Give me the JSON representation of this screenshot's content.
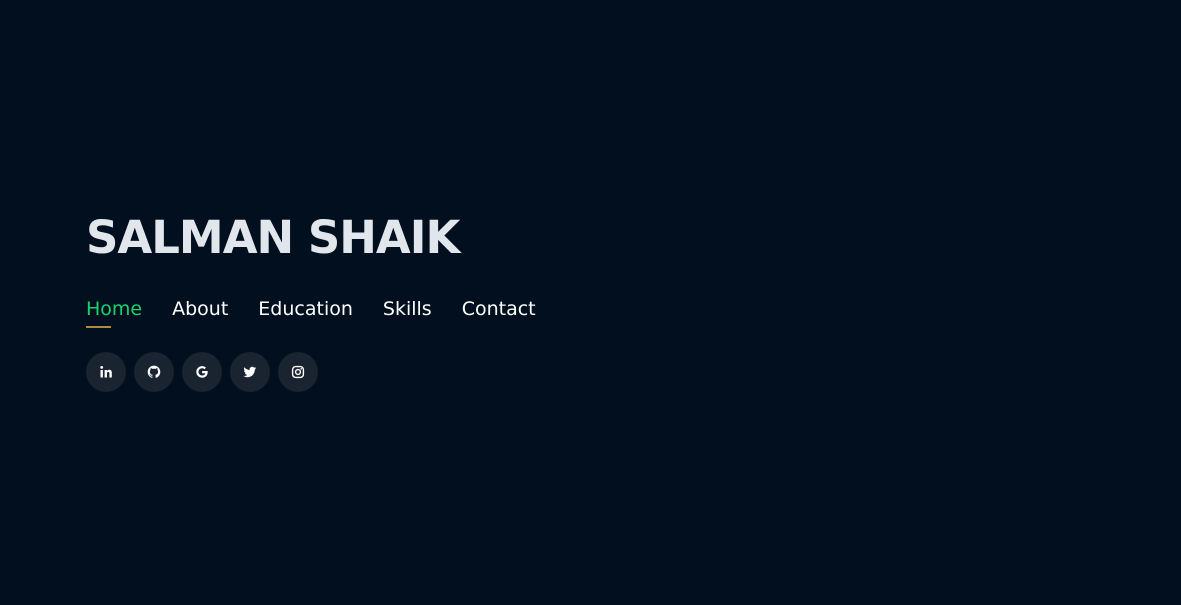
{
  "header": {
    "title": "SALMAN SHAIK"
  },
  "nav": {
    "items": [
      {
        "label": "Home",
        "active": true
      },
      {
        "label": "About",
        "active": false
      },
      {
        "label": "Education",
        "active": false
      },
      {
        "label": "Skills",
        "active": false
      },
      {
        "label": "Contact",
        "active": false
      }
    ]
  },
  "social": [
    {
      "icon": "linkedin-icon"
    },
    {
      "icon": "github-icon"
    },
    {
      "icon": "google-icon"
    },
    {
      "icon": "twitter-icon"
    },
    {
      "icon": "instagram-icon"
    }
  ],
  "colors": {
    "background": "#010f1e",
    "title": "#e1e5ec",
    "nav_text": "#ffffff",
    "nav_active": "#18d26e",
    "nav_underline": "#b38a43",
    "social_bg": "#1a2430"
  }
}
